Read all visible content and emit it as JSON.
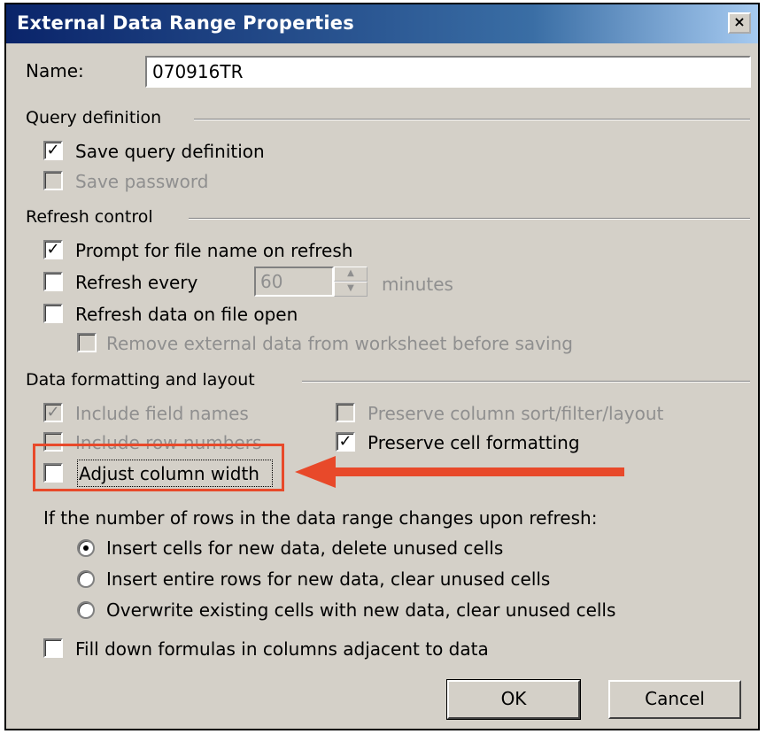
{
  "window": {
    "title": "External Data Range Properties",
    "close_glyph": "×"
  },
  "name_field": {
    "label": "Name:",
    "value": "070916TR"
  },
  "query_definition": {
    "header": "Query definition",
    "save_query": {
      "label": "Save query definition",
      "checked": true,
      "enabled": true
    },
    "save_password": {
      "label": "Save password",
      "checked": false,
      "enabled": false
    }
  },
  "refresh_control": {
    "header": "Refresh control",
    "prompt_file": {
      "label": "Prompt for file name on refresh",
      "checked": true
    },
    "refresh_every": {
      "label": "Refresh every",
      "checked": false,
      "value": "60",
      "unit": "minutes"
    },
    "refresh_on_open": {
      "label": "Refresh data on file open",
      "checked": false
    },
    "remove_external": {
      "label": "Remove external data from worksheet before saving",
      "checked": false,
      "enabled": false
    }
  },
  "data_formatting": {
    "header": "Data formatting and layout",
    "include_field_names": {
      "label": "Include field names",
      "checked": true,
      "enabled": false
    },
    "include_row_numbers": {
      "label": "Include row numbers",
      "checked": false,
      "enabled": false
    },
    "adjust_column_width": {
      "label": "Adjust column width",
      "checked": false,
      "enabled": true
    },
    "preserve_sort": {
      "label": "Preserve column sort/filter/layout",
      "checked": false,
      "enabled": false
    },
    "preserve_cell_formatting": {
      "label": "Preserve cell formatting",
      "checked": true,
      "enabled": true
    }
  },
  "rows_change": {
    "prompt": "If the number of rows in the data range changes upon refresh:",
    "options": [
      {
        "label": "Insert cells for new data, delete unused cells",
        "selected": true
      },
      {
        "label": "Insert entire rows for new data, clear unused cells",
        "selected": false
      },
      {
        "label": "Overwrite existing cells with new data, clear unused cells",
        "selected": false
      }
    ]
  },
  "fill_down": {
    "label": "Fill down formulas in columns adjacent to data",
    "checked": false
  },
  "buttons": {
    "ok": "OK",
    "cancel": "Cancel"
  },
  "annotation": {
    "color": "#e8492a"
  },
  "icons": {
    "check": "checkmark-icon",
    "radio": "radio-dot-icon",
    "arrow": "arrow-left-icon"
  }
}
